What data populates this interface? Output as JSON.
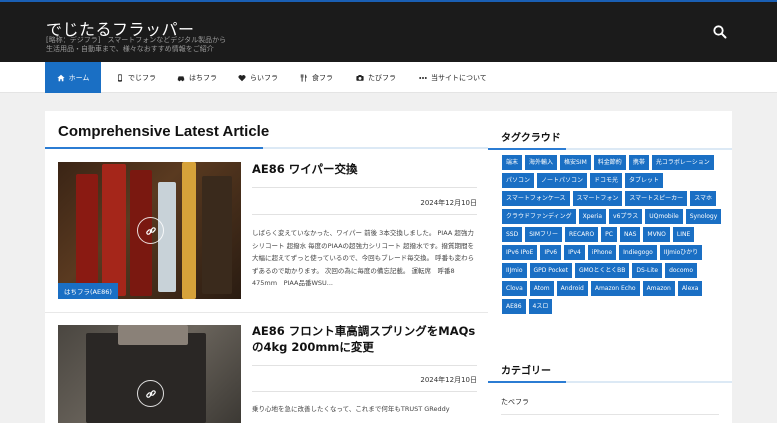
{
  "header": {
    "site_title": "でじたるフラッパー",
    "site_description": "[略称：デジフラ]　スマートフォンなどデジタル製品から生活用品・自動車まで、様々なおすすめ情報をご紹介",
    "search_icon": "search-icon"
  },
  "nav": {
    "items": [
      {
        "label": "ホーム",
        "icon": "home-icon",
        "active": true
      },
      {
        "label": "でじフラ",
        "icon": "smartphone-icon"
      },
      {
        "label": "はちフラ",
        "icon": "car-icon"
      },
      {
        "label": "らいフラ",
        "icon": "heart-icon"
      },
      {
        "label": "食フラ",
        "icon": "utensils-icon"
      },
      {
        "label": "たびフラ",
        "icon": "camera-icon"
      },
      {
        "label": "当サイトについて",
        "icon": "more-icon"
      }
    ]
  },
  "main": {
    "section_title": "Comprehensive Latest Article",
    "articles": [
      {
        "title": "AE86 ワイパー交換",
        "date": "2024年12月10日",
        "category": "はちフラ(AE86)",
        "excerpt": "しばらく変えていなかった、ワイパー 前後 3本交換しました。 PIAA 超強力シリコート 超撥水 毎度のPIAAの超強力シリコート 超撥水です。撥質期間を大幅に超えてずっと使っているので、今回もブレード毎交換。 呼番も変わらずあるので助かります。 次回の為に毎度の備忘記載。 運転席　呼番8　475mm　PIAA品番WSU..."
      },
      {
        "title": "AE86 フロント車高調スプリングをMAQsの4kg 200mmに変更",
        "date": "2024年12月10日",
        "excerpt": "乗り心地を急に改善したくなって、これまで何年もTRUST GReddy"
      }
    ]
  },
  "sidebar": {
    "tagcloud_title": "タグクラウド",
    "tags": [
      "端末",
      "海外輸入",
      "格安SIM",
      "料金節約",
      "携帯",
      "光コラボレーション",
      "パソコン",
      "ノートパソコン",
      "ドコモ光",
      "タブレット",
      "スマートフォンケース",
      "スマートフォン",
      "スマートスピーカー",
      "スマホ",
      "クラウドファンディング",
      "Xperia",
      "v6プラス",
      "UQmobile",
      "Synology",
      "SSD",
      "SIMフリー",
      "RECARO",
      "PC",
      "NAS",
      "MVNO",
      "LINE",
      "IPv6 IPoE",
      "IPv6",
      "IPv4",
      "iPhone",
      "Indiegogo",
      "IIJmioひかり",
      "IIJmio",
      "GPD Pocket",
      "GMOとくとくBB",
      "DS-Lite",
      "docomo",
      "Clova",
      "Atom",
      "Android",
      "Amazon Echo",
      "Amazon",
      "Alexa",
      "AE86",
      "4スロ"
    ],
    "category_title": "カテゴリー",
    "categories": [
      {
        "label": "たべフラ"
      }
    ]
  },
  "colors": {
    "accent": "#1a6fc4",
    "header_bg": "#1b1b1b",
    "page_bg": "#f0f0f0"
  }
}
